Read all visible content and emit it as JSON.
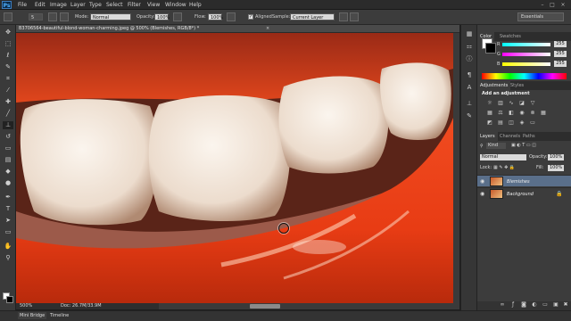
{
  "app": {
    "logo": "Ps"
  },
  "menu": [
    "File",
    "Edit",
    "Image",
    "Layer",
    "Type",
    "Select",
    "Filter",
    "View",
    "Window",
    "Help"
  ],
  "window_controls": [
    "–",
    "□",
    "×"
  ],
  "options_bar": {
    "brush_size": "5",
    "mode_label": "Mode:",
    "mode_value": "Normal",
    "opacity_label": "Opacity:",
    "opacity_value": "100%",
    "flow_label": "Flow:",
    "flow_value": "100%",
    "aligned_label": "Aligned",
    "sample_label": "Sample:",
    "sample_value": "Current Layer",
    "workspace": "Essentials"
  },
  "document": {
    "tab_title": "B3706564-beautiful-blond-woman-charming.jpeg @ 500% (Blemishes, RGB/8*) *",
    "close": "×",
    "zoom": "500%",
    "doc_info": "Doc: 26.7M/33.9M"
  },
  "bottom_tabs": [
    "Mini Bridge",
    "Timeline"
  ],
  "color_panel": {
    "tabs": [
      "Color",
      "Swatches"
    ],
    "sliders": [
      {
        "letter": "R",
        "value": "255"
      },
      {
        "letter": "G",
        "value": "255"
      },
      {
        "letter": "B",
        "value": "255"
      }
    ],
    "foreground": "#ffffff",
    "background": "#000000"
  },
  "adjustments_panel": {
    "tabs": [
      "Adjustments",
      "Styles"
    ],
    "title": "Add an adjustment"
  },
  "layers_panel": {
    "tabs": [
      "Layers",
      "Channels",
      "Paths"
    ],
    "filter_label": "Kind",
    "blend_mode": "Normal",
    "opacity_label": "Opacity:",
    "opacity_value": "100%",
    "lock_label": "Lock:",
    "fill_label": "Fill:",
    "fill_value": "100%",
    "layers": [
      {
        "name": "Blemishes",
        "selected": true
      },
      {
        "name": "Background",
        "selected": false
      }
    ]
  },
  "icons": {
    "tools": [
      "move-icon",
      "marquee-icon",
      "lasso-icon",
      "quick-select-icon",
      "crop-icon",
      "eyedropper-icon",
      "healing-icon",
      "brush-icon",
      "clone-stamp-icon",
      "history-brush-icon",
      "eraser-icon",
      "gradient-icon",
      "blur-icon",
      "dodge-icon",
      "pen-icon",
      "type-icon",
      "path-select-icon",
      "shape-icon",
      "hand-icon",
      "zoom-icon"
    ],
    "eye": "eye-icon",
    "lock": "lock-icon"
  }
}
